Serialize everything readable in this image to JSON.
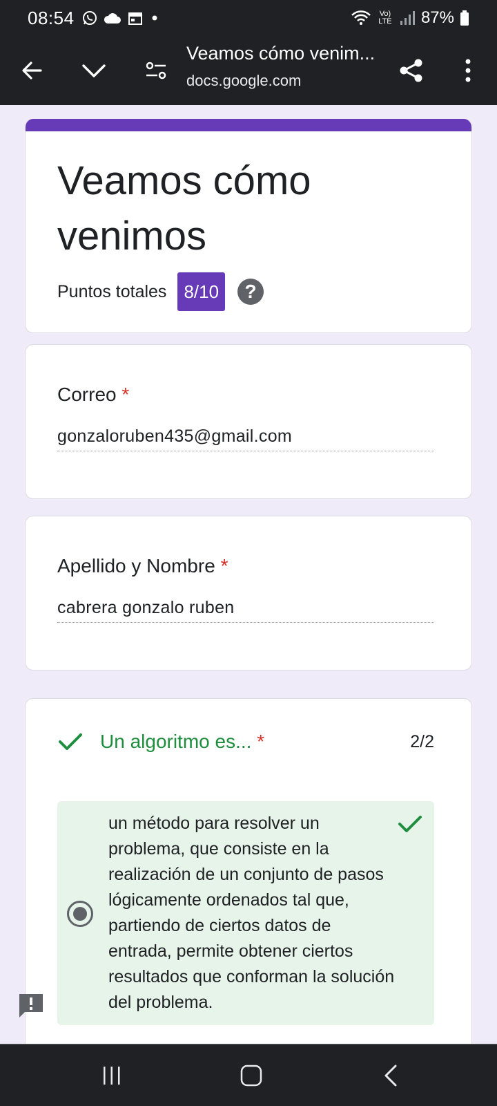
{
  "status_bar": {
    "time": "08:54",
    "battery": "87%",
    "network_label": "Vo) LTE",
    "left_icons": [
      "whatsapp-icon",
      "cloud-icon",
      "calendar-icon",
      "dot-icon"
    ],
    "right_icons": [
      "wifi-icon",
      "signal-icon",
      "battery-icon"
    ]
  },
  "browser": {
    "page_title": "Veamos cómo venim...",
    "url": "docs.google.com",
    "icons": [
      "back-arrow-icon",
      "chevron-down-icon",
      "page-settings-icon",
      "share-icon",
      "more-vert-icon"
    ]
  },
  "form": {
    "title": "Veamos cómo venimos",
    "score_label": "Puntos totales",
    "score_value": "8/10",
    "help_glyph": "?",
    "accent_color": "#673ab7"
  },
  "questions": [
    {
      "label": "Correo",
      "required": "*",
      "answer": "gonzaloruben435@gmail.com"
    },
    {
      "label": "Apellido y Nombre",
      "required": "*",
      "answer": "cabrera gonzalo ruben"
    }
  ],
  "quiz": {
    "question": "Un algoritmo es...",
    "required": "*",
    "score": "2/2",
    "status": "correct",
    "correct_color": "#1e8e3e",
    "selected_answer": "un método para resolver un problema, que consiste en la realización de un conjunto de pasos lógicamente ordenados tal que, partiendo de ciertos datos de entrada, permite obtener ciertos resultados que conforman la solución del problema."
  },
  "nav_bar": {
    "icons": [
      "recent-apps-icon",
      "home-icon",
      "nav-back-icon"
    ]
  }
}
